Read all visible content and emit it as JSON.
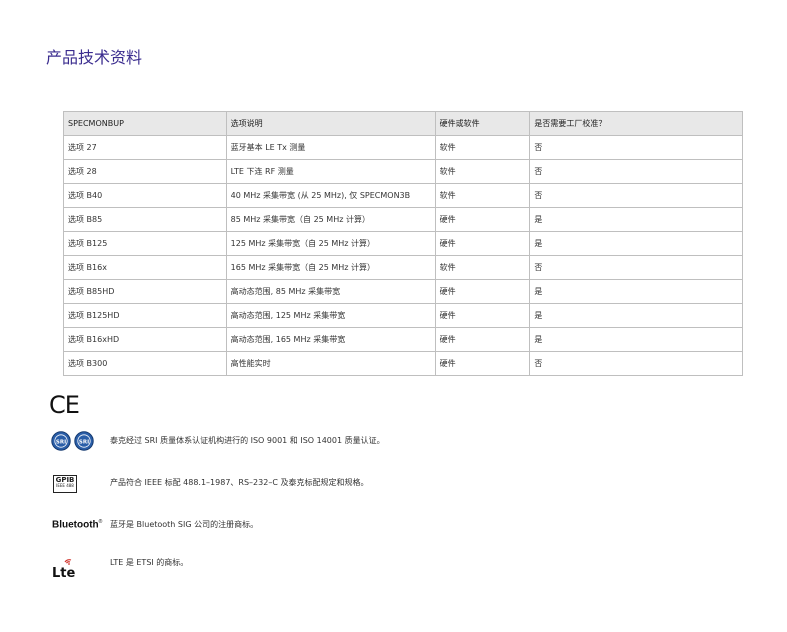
{
  "page": {
    "title": "产品技术资料"
  },
  "table": {
    "headers": [
      "SPECMONBUP",
      "选项说明",
      "硬件或软件",
      "是否需要工厂校准？"
    ],
    "rows": [
      [
        "选项 27",
        "蓝牙基本 LE Tx 测量",
        "软件",
        "否"
      ],
      [
        "选项 28",
        "LTE 下连 RF 测量",
        "软件",
        "否"
      ],
      [
        "选项 B40",
        "40 MHz 采集带宽 (从 25 MHz), 仅 SPECMON3B",
        "软件",
        "否"
      ],
      [
        "选项 B85",
        "85 MHz 采集带宽（自 25 MHz 计算）",
        "硬件",
        "是"
      ],
      [
        "选项 B125",
        "125 MHz 采集带宽（自 25 MHz 计算）",
        "硬件",
        "是"
      ],
      [
        "选项 B16x",
        "165 MHz 采集带宽（自 25 MHz 计算）",
        "软件",
        "否"
      ],
      [
        "选项 B85HD",
        "高动态范围, 85 MHz 采集带宽",
        "硬件",
        "是"
      ],
      [
        "选项 B125HD",
        "高动态范围, 125 MHz 采集带宽",
        "硬件",
        "是"
      ],
      [
        "选项 B16xHD",
        "高动态范围, 165 MHz 采集带宽",
        "硬件",
        "是"
      ],
      [
        "选项 B300",
        "高性能实时",
        "硬件",
        "否"
      ]
    ]
  },
  "certifications": {
    "ce_mark": "CE",
    "sri": {
      "badge_text": "SRI",
      "text": "泰克经过 SRI 质量体系认证机构进行的 ISO 9001 和 ISO 14001 质量认证。"
    },
    "gpib": {
      "logo_main": "GPIB",
      "logo_sub": "IEEE 488",
      "text": "产品符合 IEEE 标配 488.1–1987、RS–232–C 及泰克标配规定和规格。"
    },
    "bluetooth": {
      "logo_text": "Bluetooth",
      "logo_mark": "®",
      "text": "蓝牙是 Bluetooth SIG 公司的注册商标。"
    },
    "lte": {
      "logo_text": "Lte",
      "text": "LTE 是 ETSI 的商标。"
    }
  }
}
